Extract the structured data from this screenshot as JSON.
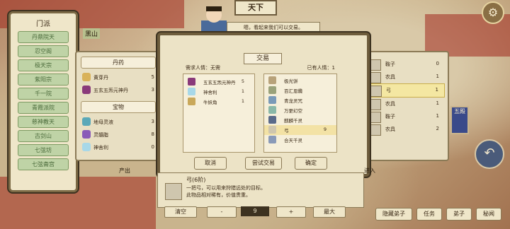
{
  "top_title": "天下",
  "speech": "嗯，看起来我们可以交易。",
  "map_label": "黑山",
  "sect_panel": {
    "title": "门派",
    "items": [
      "丹鼎院天",
      "忍空阁",
      "极天宗",
      "紫阳宗",
      "千一院",
      "青霞派院",
      "慈神教天",
      "古剑山",
      "七弦坊",
      "七弦斋宫"
    ]
  },
  "left_panel": {
    "section1": "丹药",
    "items1": [
      {
        "name": "黄芽丹",
        "count": "5",
        "color": "#d9b25a"
      },
      {
        "name": "五玄五炁元神丹",
        "count": "3",
        "color": "#8a3a7a"
      }
    ],
    "section2": "宝物",
    "items2": [
      {
        "name": "地母灵液",
        "count": "3",
        "color": "#5aa8b8"
      },
      {
        "name": "灵髓脂",
        "count": "8",
        "color": "#8a5ab8"
      },
      {
        "name": "神舍利",
        "count": "0",
        "color": "#a8d8e8"
      }
    ]
  },
  "right_panel": {
    "items": [
      {
        "name": "鞍子",
        "count": "0"
      },
      {
        "name": "农具",
        "count": "1"
      },
      {
        "name": "弓",
        "count": "1",
        "selected": true
      },
      {
        "name": "农具",
        "count": "1"
      },
      {
        "name": "鞍子",
        "count": "1"
      },
      {
        "name": "农具",
        "count": "2"
      }
    ]
  },
  "trade": {
    "title": "交易",
    "required": "需求人情：无需",
    "have": "已有人情：1",
    "left_items": [
      {
        "name": "五玄五炁元神丹",
        "count": "5",
        "color": "#8a3a7a"
      },
      {
        "name": "神舍利",
        "count": "1",
        "color": "#a8d8e8"
      },
      {
        "name": "牛妖角",
        "count": "1",
        "color": "#c9a85a"
      }
    ],
    "right_items": [
      {
        "name": "极光饼",
        "count": ""
      },
      {
        "name": "百汇恩纜",
        "count": ""
      },
      {
        "name": "青龙灵咒",
        "count": ""
      },
      {
        "name": "万更幻空",
        "count": ""
      },
      {
        "name": "麒麟千灵",
        "count": ""
      },
      {
        "name": "弓",
        "count": "9",
        "selected": true
      },
      {
        "name": "合天千灵",
        "count": ""
      }
    ],
    "buttons": {
      "cancel": "取消",
      "try": "尝试交易",
      "confirm": "确定"
    }
  },
  "info": {
    "title": "弓(6阶)",
    "line1": "一把弓，可以用来狩猎远处的目标。",
    "line2": "此物品相对稀有，价值贵重。"
  },
  "qty": {
    "clear": "清空",
    "minus": "-",
    "value": "9",
    "plus": "+",
    "max": "最大"
  },
  "bottom": {
    "hide": "隐藏弟子",
    "task": "任务",
    "disciple": "弟子",
    "secret": "秘闻"
  },
  "side_tag": "五殿",
  "labels": {
    "produce": "产出",
    "enter": "进入"
  }
}
